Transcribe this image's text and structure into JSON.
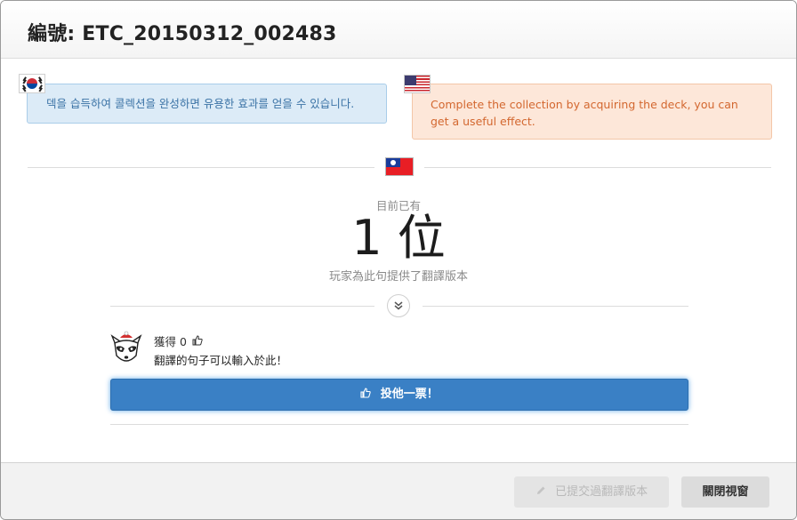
{
  "header": {
    "title": "編號: ETC_20150312_002483"
  },
  "source": {
    "korean_text": "덱을 습득하여 콜렉션을 완성하면 유용한 효과를 얻을 수 있습니다.",
    "english_text": "Complete the collection by acquiring the deck, you can get a useful effect."
  },
  "stats": {
    "label": "目前已有",
    "count": "1 位",
    "subtitle": "玩家為此句提供了翻譯版本"
  },
  "translation": {
    "votes_label": "獲得 0",
    "text": "翻譯的句子可以輸入於此！",
    "vote_button": "投他一票！"
  },
  "footer": {
    "submitted_button": "已提交過翻譯版本",
    "close_button": "關閉視窗"
  },
  "icons": {
    "thumbs_up": "thumbs-up-icon",
    "pencil": "pencil-icon",
    "expand": "double-chevron-down-icon"
  },
  "colors": {
    "vote_button_bg": "#3a80c5",
    "korean_box_bg": "#dcebf7",
    "english_box_bg": "#fde7d9"
  }
}
